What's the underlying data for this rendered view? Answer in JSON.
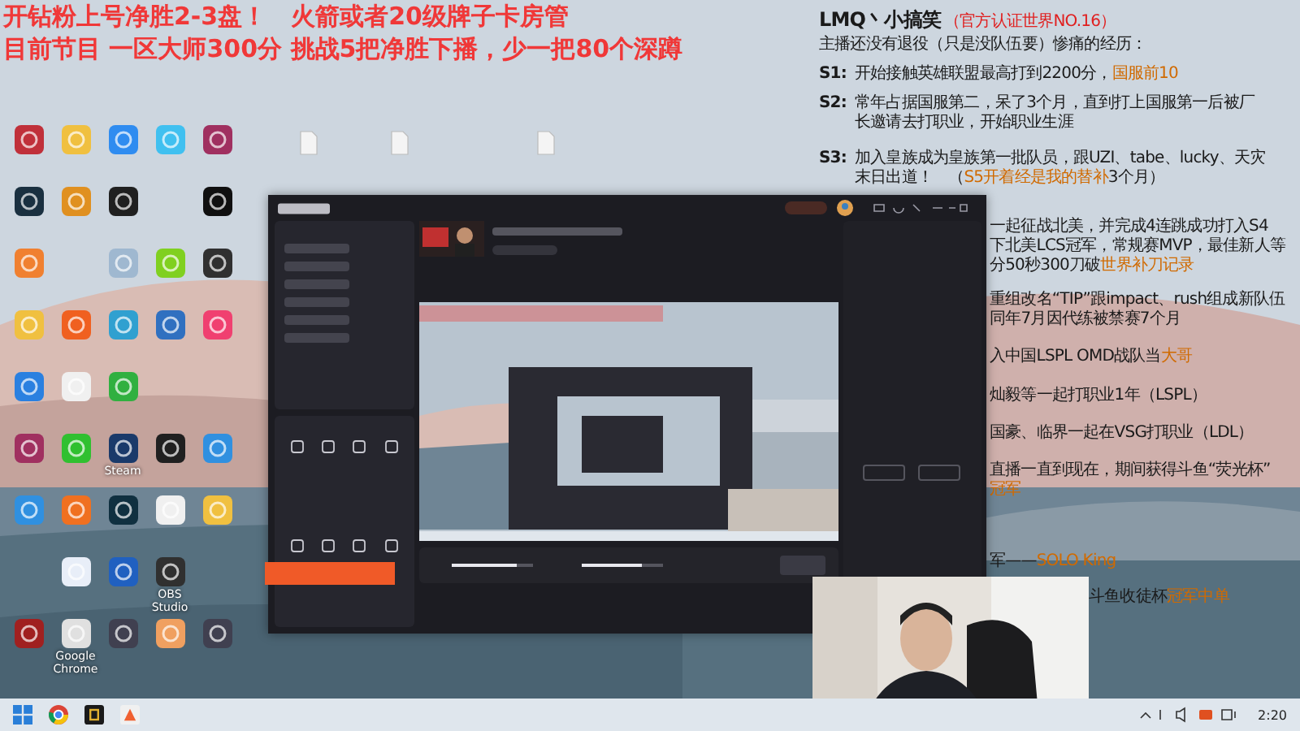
{
  "overlay_title": [
    "开钻粉上号净胜2-3盘！　火箭或者20级牌子卡房管",
    "目前节目 一区大师300分 挑战5把净胜下播，少一把80个深蹲"
  ],
  "bio": {
    "name": "LMQ丶小搞笑",
    "badge": "（官方认证世界NO.16）",
    "groups": [
      {
        "kind": "full",
        "lines": [
          {
            "text": "主播还没有退役（只是没队伍要）惨痛的经历："
          }
        ]
      },
      {
        "kind": "full",
        "label": "S1:",
        "lines": [
          {
            "text": "开始接触英雄联盟最高打到2200分，",
            "highlight": "国服前10"
          }
        ]
      },
      {
        "kind": "full",
        "label": "S2:",
        "lines": [
          {
            "text": "常年占据国服第二，呆了3个月，直到打上国服第一后被厂"
          },
          {
            "text": "长邀请去打职业，开始职业生涯"
          }
        ]
      },
      {
        "kind": "full",
        "label": "S3:",
        "lines": [
          {
            "text": "加入皇族成为皇族第一批队员，跟UZI、tabe、lucky、天灾"
          },
          {
            "text": "末日出道！　（",
            "highlight": "S5开着经是我的替补",
            "after": "3个月）"
          }
        ]
      },
      {
        "kind": "clipped",
        "lines": [
          {
            "text": "一起征战北美，并完成4连跳成功打入S4"
          },
          {
            "text": "下北美LCS冠军，常规赛MVP，最佳新人等"
          },
          {
            "text": "分50秒300刀破",
            "highlight": "世界补刀记录"
          }
        ]
      },
      {
        "kind": "clipped",
        "lines": [
          {
            "text": "重组改名“TIP”跟impact、rush组成新队伍"
          },
          {
            "text": "同年7月因代练被禁赛7个月"
          }
        ]
      },
      {
        "kind": "clipped",
        "lines": [
          {
            "text": "入中国LSPL OMD战队当",
            "highlight": "大哥"
          }
        ]
      },
      {
        "kind": "clipped",
        "lines": [
          {
            "text": "灿毅等一起打职业1年（LSPL）"
          }
        ]
      },
      {
        "kind": "clipped",
        "lines": [
          {
            "text": "国豪、临界一起在VSG打职业（LDL）"
          }
        ]
      },
      {
        "kind": "clipped",
        "lines": [
          {
            "text": "直播一直到现在，期间获得斗鱼“荧光杯”"
          },
          {
            "highlight": "冠军"
          }
        ]
      },
      {
        "kind": "clipped",
        "lines": [
          {
            "text": "军——",
            "highlight": "SOLO King"
          }
        ]
      },
      {
        "kind": "under-camera",
        "lines": [
          {
            "text": "斗鱼收徒杯",
            "highlight": "冠军中单"
          }
        ]
      }
    ]
  },
  "desktop_icons": [
    {
      "color": "#c0303a"
    },
    {
      "color": "#f0c040"
    },
    {
      "color": "#2f8cf0"
    },
    {
      "color": "#40c0f0"
    },
    {
      "color": "#a03060"
    },
    {
      "color": "#1a3040"
    },
    {
      "color": "#e09020"
    },
    {
      "color": "#202020"
    },
    {
      "color": "#101010"
    },
    {
      "color": "#f08030"
    },
    {
      "color": "#9fb8d0"
    },
    {
      "color": "#80d020"
    },
    {
      "color": "#303030"
    },
    {
      "color": "#f0c040"
    },
    {
      "color": "#f06020"
    },
    {
      "color": "#30a0d0"
    },
    {
      "color": "#3070c0"
    },
    {
      "color": "#f04070"
    },
    {
      "color": "#2a80e0"
    },
    {
      "color": "#f0f0f0"
    },
    {
      "color": "#30b040"
    },
    {
      "color": "#a03060"
    },
    {
      "color": "#30c030"
    },
    {
      "color": "#1a3a6a",
      "label": "Steam"
    },
    {
      "color": "#202020"
    },
    {
      "color": "#3090e0"
    },
    {
      "color": "#3090e0"
    },
    {
      "color": "#f07020"
    },
    {
      "color": "#103040"
    },
    {
      "color": "#f0f0f0"
    },
    {
      "color": "#f0c040"
    },
    {
      "color": "#e8eef8"
    },
    {
      "color": "#2060c0"
    },
    {
      "color": "#303030",
      "label": "OBS Studio"
    },
    {
      "color": "#a02020"
    },
    {
      "color": "#e0e0e0",
      "label": "Google Chrome"
    },
    {
      "color": "#404050"
    },
    {
      "color": "#f0a060"
    },
    {
      "color": "#404050"
    }
  ],
  "stream_app": {
    "sliders": [
      {
        "level": 0.8
      },
      {
        "level": 0.75
      }
    ]
  },
  "taskbar": {
    "clock": "2:20"
  }
}
